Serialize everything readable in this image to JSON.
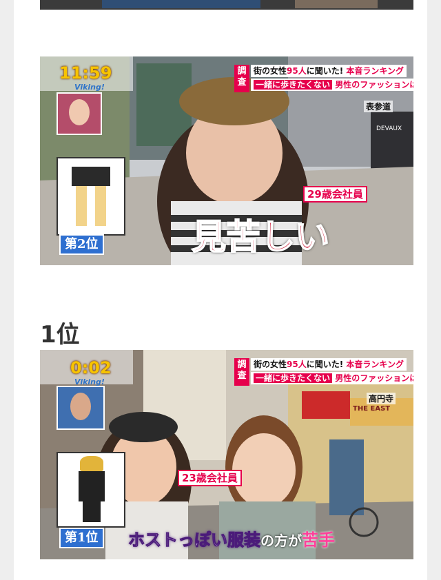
{
  "heading_rank1": "1位",
  "broadcast": {
    "viking_logo": "Viking!",
    "survey_tag": "調査",
    "banner_line1_a": "街の女性",
    "banner_line1_count": "95人",
    "banner_line1_b": "に聞いた!",
    "banner_line1_c": "本音ランキング",
    "banner_line2_a": "一緒に歩きたくない",
    "banner_line2_b": "男性のファッションは?"
  },
  "image2": {
    "clock": "11:59",
    "location": "表参道",
    "age_label": "29歳会社員",
    "rank_badge": "第2位",
    "caption": "見苦しい",
    "store_sign": "DEVAUX"
  },
  "image3": {
    "clock": "0:02",
    "location": "高円寺",
    "age_label": "23歳会社員",
    "rank_badge": "第1位",
    "caption_main": "ホストっぽい服装",
    "caption_mid": "の方が",
    "caption_end": "苦手",
    "store_sign": "THE EAST"
  },
  "colors": {
    "accent_pink": "#e6004c",
    "rank_blue": "#2e6fd0",
    "clock_yellow": "#f7c400"
  }
}
